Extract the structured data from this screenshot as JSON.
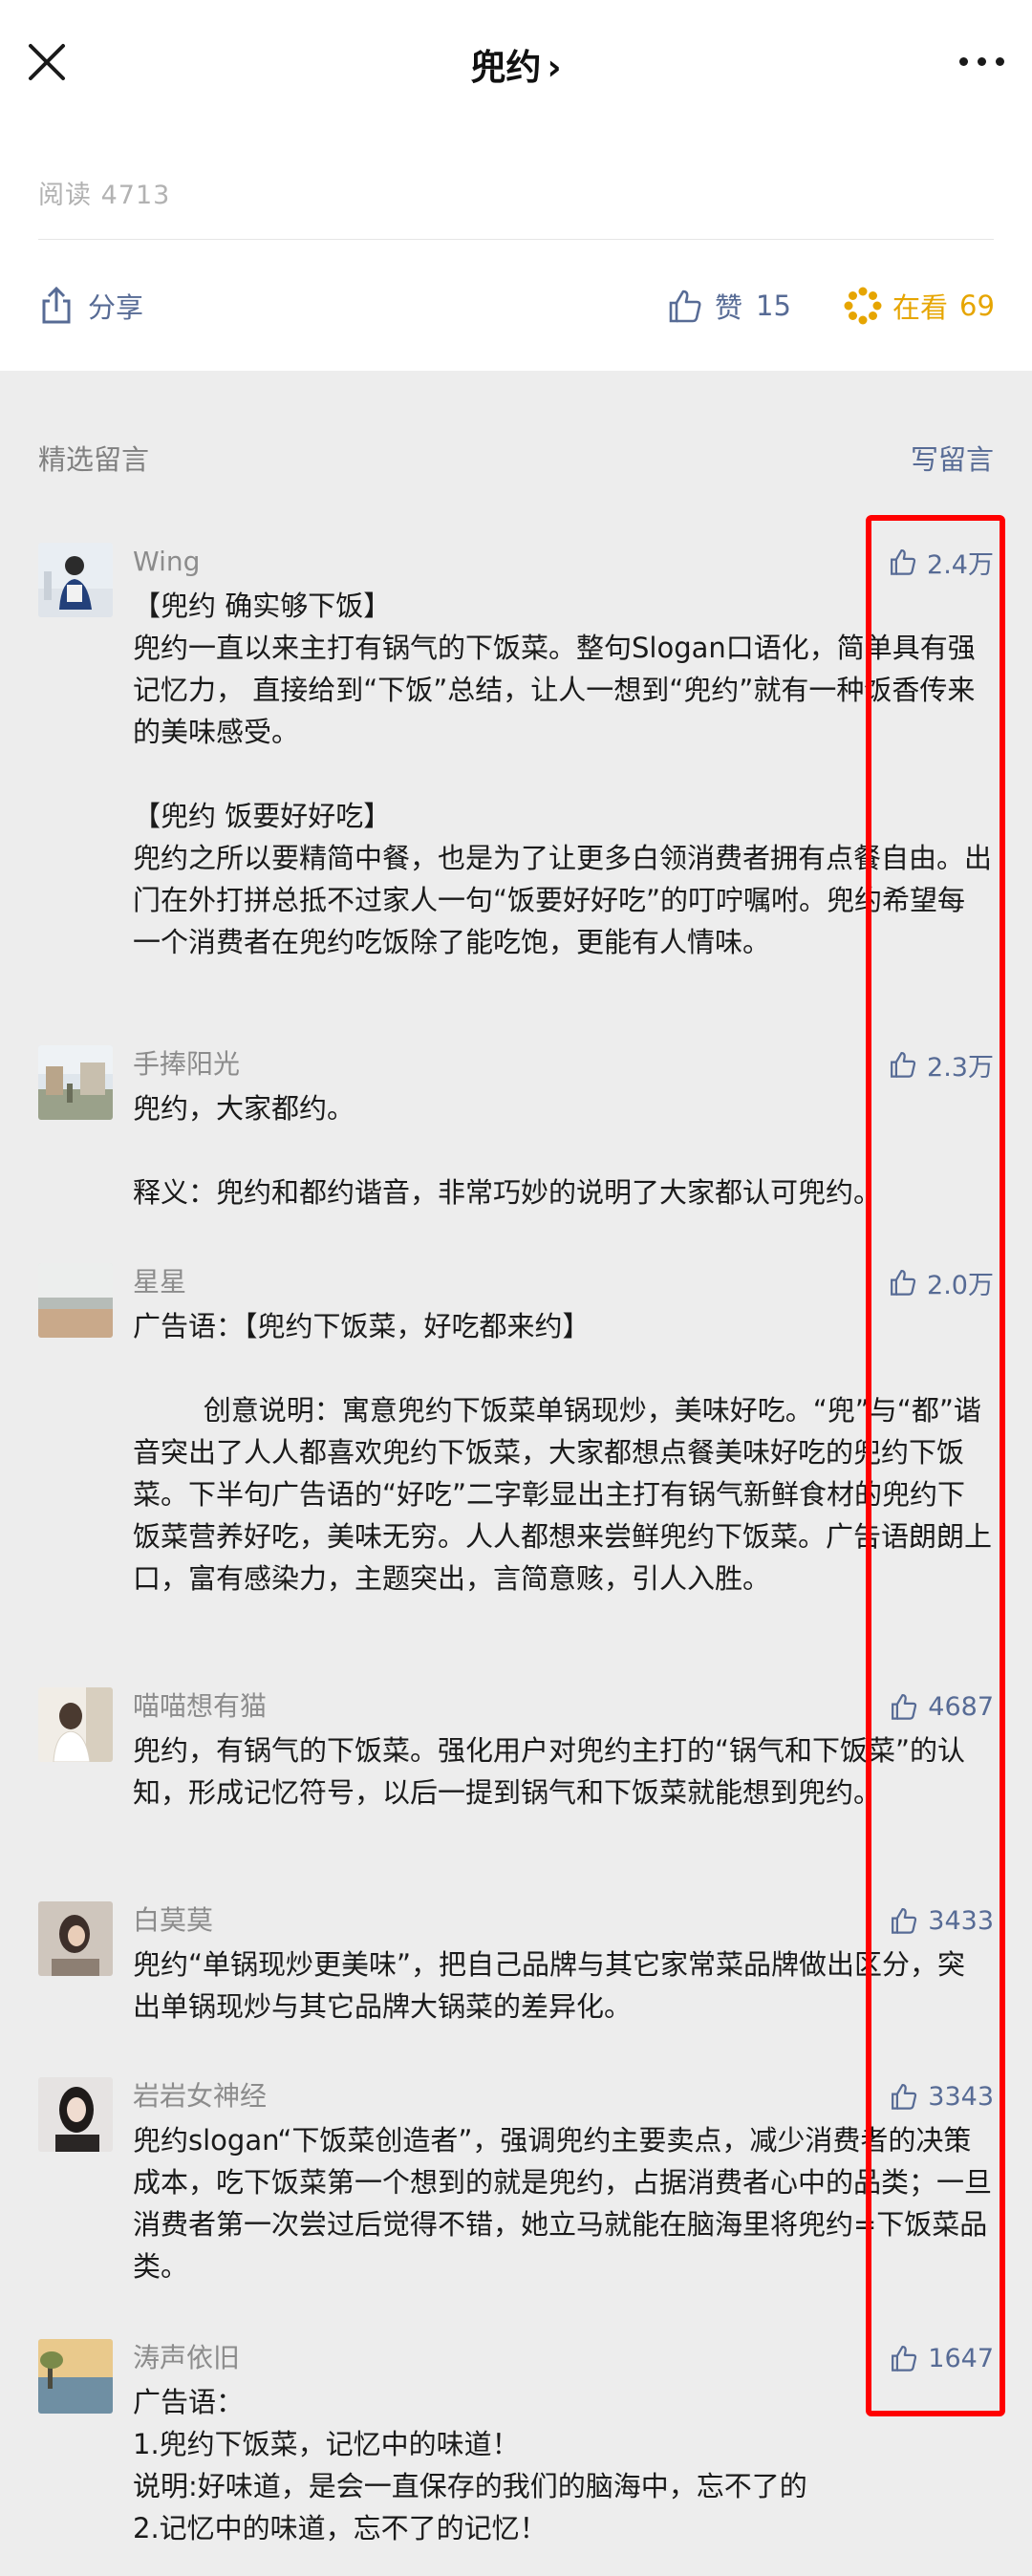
{
  "header": {
    "title": "兜约",
    "chevron": "›"
  },
  "article": {
    "read_label": "阅读",
    "read_count": "4713",
    "share_label": "分享",
    "like_label": "赞",
    "like_count": "15",
    "watch_label": "在看",
    "watch_count": "69"
  },
  "comments_section": {
    "title": "精选留言",
    "write_label": "写留言",
    "items": [
      {
        "nickname": "Wing",
        "likes": "2.4万",
        "text": "【兜约 确实够下饭】\n兜约一直以来主打有锅气的下饭菜。整句Slogan口语化，简单具有强记忆力， 直接给到“下饭”总结，让人一想到“兜约”就有一种饭香传来的美味感受。\n\n【兜约 饭要好好吃】\n兜约之所以要精简中餐，也是为了让更多白领消费者拥有点餐自由。出门在外打拼总抵不过家人一句“饭要好好吃”的叮咛嘱咐。兜约希望每一个消费者在兜约吃饭除了能吃饱，更能有人情味。"
      },
      {
        "nickname": "手捧阳光",
        "likes": "2.3万",
        "text": "兜约，大家都约。\n\n释义：兜约和都约谐音，非常巧妙的说明了大家都认可兜约。"
      },
      {
        "nickname": "星星",
        "likes": "2.0万",
        "text": "广告语：【兜约下饭菜，好吃都来约】\n\n        创意说明：寓意兜约下饭菜单锅现炒，美味好吃。“兜”与“都”谐音突出了人人都喜欢兜约下饭菜，大家都想点餐美味好吃的兜约下饭菜。下半句广告语的“好吃”二字彰显出主打有锅气新鲜食材的兜约下饭菜营养好吃，美味无穷。人人都想来尝鲜兜约下饭菜。广告语朗朗上口，富有感染力，主题突出，言简意赅，引人入胜。"
      },
      {
        "nickname": "喵喵想有猫",
        "likes": "4687",
        "text": "兜约，有锅气的下饭菜。强化用户对兜约主打的“锅气和下饭菜”的认知，形成记忆符号，以后一提到锅气和下饭菜就能想到兜约。"
      },
      {
        "nickname": "白莫莫",
        "likes": "3433",
        "text": "兜约“单锅现炒更美味”，把自己品牌与其它家常菜品牌做出区分，突出单锅现炒与其它品牌大锅菜的差异化。"
      },
      {
        "nickname": "岩岩女神经",
        "likes": "3343",
        "text": "兜约slogan“下饭菜创造者”，强调兜约主要卖点，减少消费者的决策成本，吃下饭菜第一个想到的就是兜约，占据消费者心中的品类；一旦消费者第一次尝过后觉得不错，她立马就能在脑海里将兜约=下饭菜品类。"
      },
      {
        "nickname": "涛声依旧",
        "likes": "1647",
        "text": "广告语：\n1.兜约下饭菜，记忆中的味道！\n说明:好味道，是会一直保存的我们的脑海中，忘不了的\n2.记忆中的味道，忘不了的记忆！"
      }
    ]
  },
  "colors": {
    "link": "#576b95",
    "watch": "#e6a500",
    "highlight": "#ff0000",
    "background": "#ededed"
  }
}
